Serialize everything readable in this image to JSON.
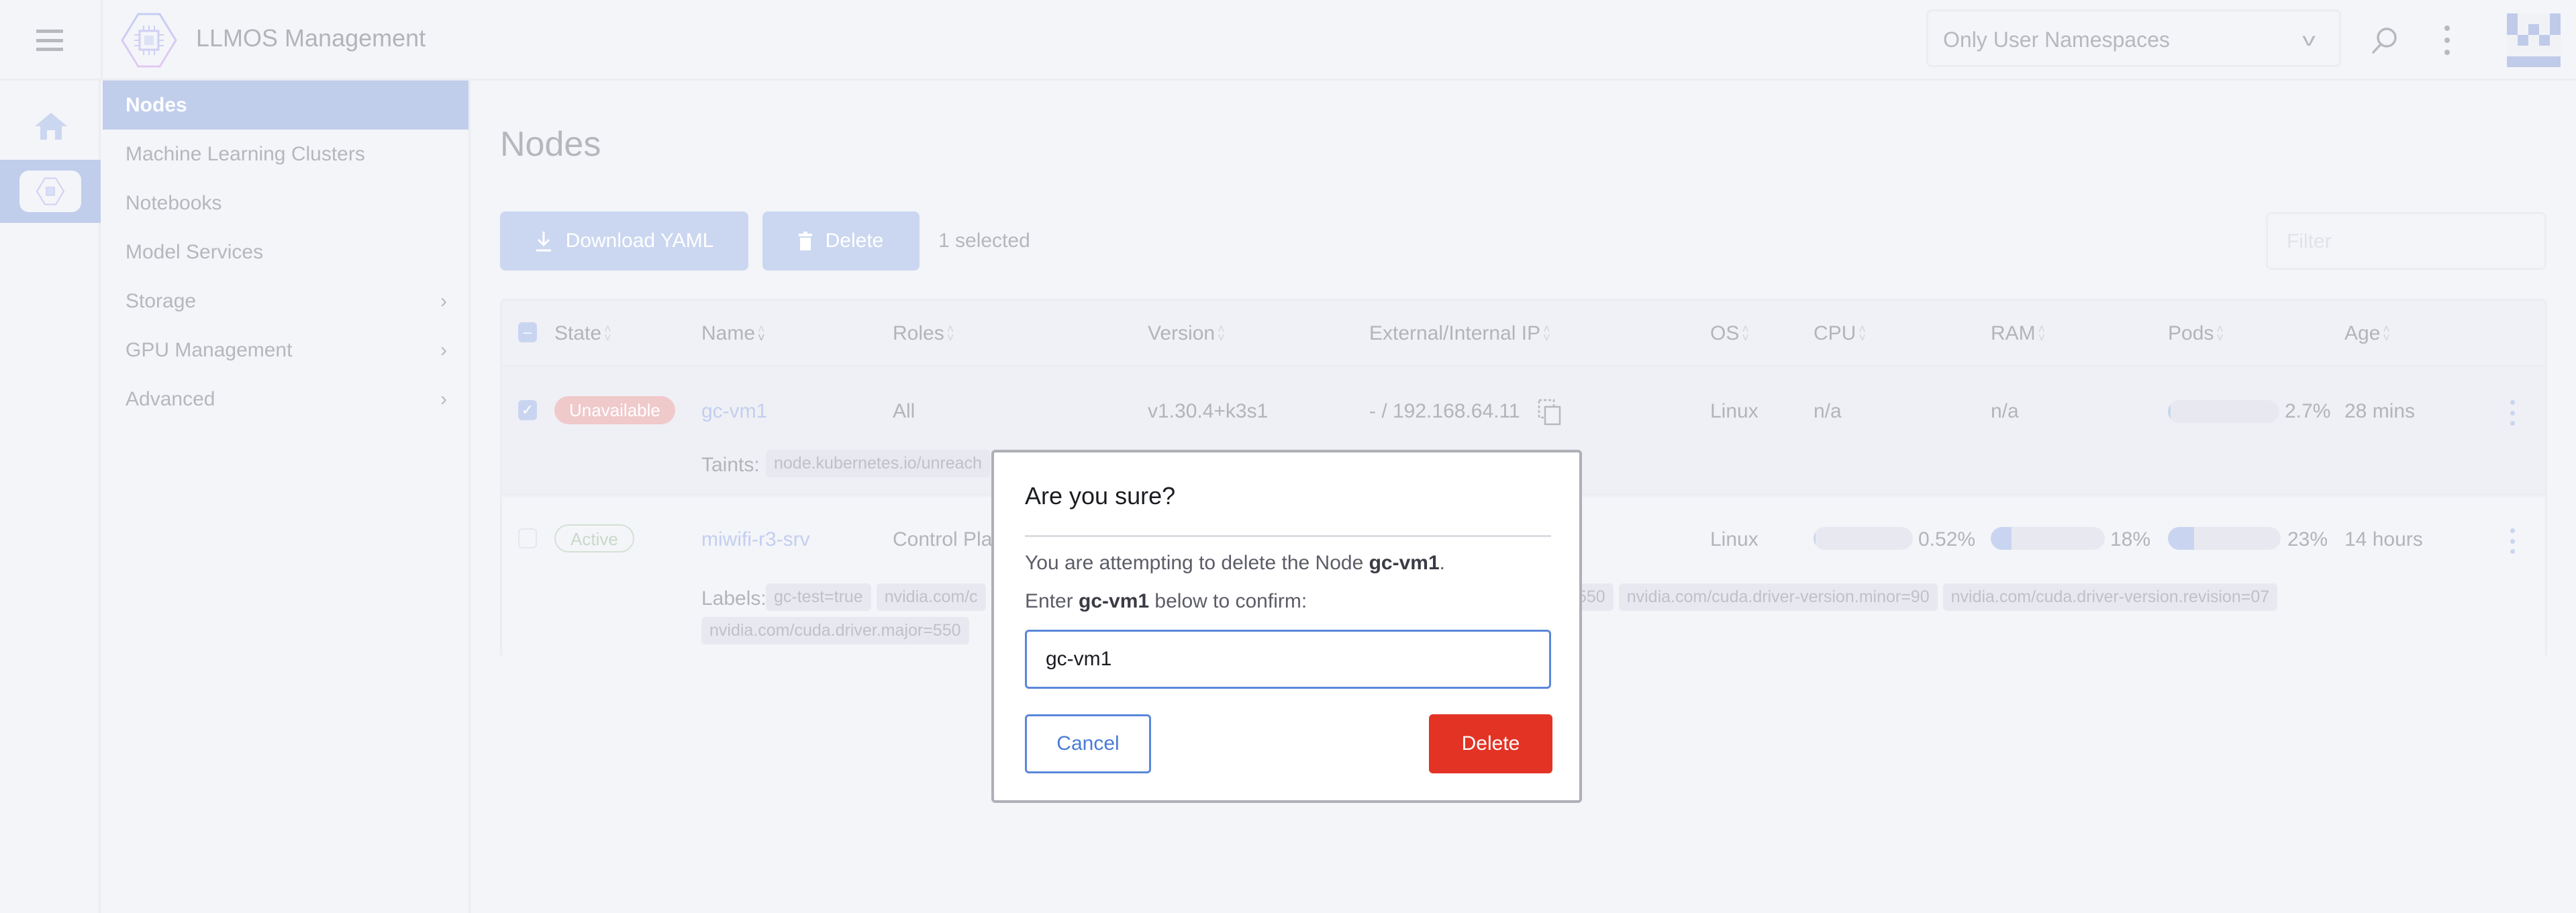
{
  "header": {
    "app_title": "LLMOS Management",
    "namespace_select": "Only User Namespaces"
  },
  "nav": {
    "items": [
      {
        "label": "Nodes",
        "active": true
      },
      {
        "label": "Machine Learning Clusters"
      },
      {
        "label": "Notebooks"
      },
      {
        "label": "Model Services"
      },
      {
        "label": "Storage",
        "expandable": true
      },
      {
        "label": "GPU Management",
        "expandable": true
      },
      {
        "label": "Advanced",
        "expandable": true
      }
    ]
  },
  "page": {
    "title": "Nodes",
    "download_yaml_label": "Download YAML",
    "delete_label": "Delete",
    "selected_count": "1 selected",
    "filter_placeholder": "Filter"
  },
  "table": {
    "columns": [
      "State",
      "Name",
      "Roles",
      "Version",
      "External/Internal IP",
      "OS",
      "CPU",
      "RAM",
      "Pods",
      "Age"
    ],
    "rows": [
      {
        "selected": true,
        "state": "Unavailable",
        "name": "gc-vm1",
        "roles": "All",
        "version": "v1.30.4+k3s1",
        "ip": "- / 192.168.64.11",
        "os": "Linux",
        "cpu": "n/a",
        "ram": "n/a",
        "pods": "2.7%",
        "pods_fraction": 0.027,
        "age": "28 mins",
        "detail_label": "Taints:",
        "detail_tags": [
          "node.kubernetes.io/unreach"
        ]
      },
      {
        "selected": false,
        "state": "Active",
        "name": "miwifi-r3-srv",
        "roles": "Control Pla",
        "os": "Linux",
        "cpu": "0.52%",
        "cpu_fraction": 0.0052,
        "ram": "18%",
        "ram_fraction": 0.18,
        "pods": "23%",
        "pods_fraction": 0.23,
        "age": "14 hours",
        "detail_label": "Labels:",
        "detail_tags": [
          "gc-test=true",
          "nvidia.com/c"
        ],
        "detail_tags_right": [
          "550",
          "nvidia.com/cuda.driver-version.minor=90",
          "nvidia.com/cuda.driver-version.revision=07"
        ],
        "detail_tags_line2": [
          "nvidia.com/cuda.driver.major=550"
        ]
      }
    ]
  },
  "modal": {
    "title": "Are you sure?",
    "text1_prefix": "You are attempting to delete the Node ",
    "text1_name": "gc-vm1",
    "text1_suffix": ".",
    "text2_prefix": "Enter ",
    "text2_name": "gc-vm1",
    "text2_suffix": " below to confirm:",
    "input_value": "gc-vm1",
    "cancel_label": "Cancel",
    "delete_label": "Delete"
  },
  "colors": {
    "accent": "#5a87d9",
    "danger": "#e33325",
    "nav_active": "#c0cdeb"
  }
}
